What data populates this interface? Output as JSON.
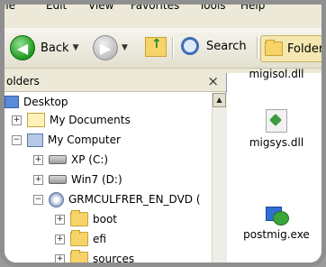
{
  "menubar": {
    "items": [
      "ile",
      "Edit",
      "View",
      "Favorites",
      "Tools",
      "Help"
    ]
  },
  "toolbar": {
    "back_label": "Back",
    "search_label": "Search",
    "folders_label": "Folders"
  },
  "folders_pane": {
    "title": "olders",
    "close_glyph": "×",
    "tree": [
      {
        "label": "Desktop"
      },
      {
        "label": "My Documents",
        "expander": "+"
      },
      {
        "label": "My Computer",
        "expander": "−"
      },
      {
        "label": "XP (C:)",
        "expander": "+"
      },
      {
        "label": "Win7 (D:)",
        "expander": "+"
      },
      {
        "label": "GRMCULFRER_EN_DVD (",
        "expander": "−"
      },
      {
        "label": "boot",
        "expander": "+"
      },
      {
        "label": "efi",
        "expander": "+"
      },
      {
        "label": "sources",
        "expander": "+"
      }
    ]
  },
  "files": [
    {
      "name": "migisol.dll"
    },
    {
      "name": "migsys.dll"
    },
    {
      "name": "postmig.exe"
    }
  ]
}
